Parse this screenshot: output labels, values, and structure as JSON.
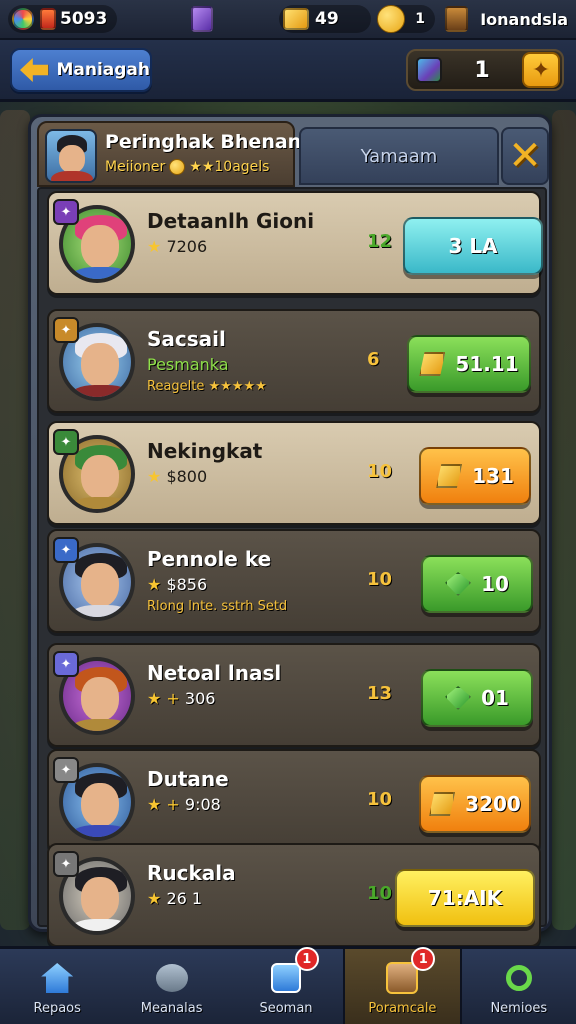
{
  "top_bar": {
    "gems": "5093",
    "gold": "49",
    "coins": "1",
    "player": "Ionandsla"
  },
  "header": {
    "back_label": "Maniagah",
    "counter_value": "1"
  },
  "panel": {
    "tab_title": "Peringhak Bhenan",
    "tab_subtitle_left": "Meiioner",
    "tab_subtitle_right": "★★10agels",
    "tab_inactive": "Yamaam"
  },
  "rows": [
    {
      "name": "Detaanlh Gioni",
      "sub": "7206",
      "sub2": "",
      "level": "12",
      "price": "3 LA",
      "style": "light",
      "button": "teal",
      "sub_prefix": "★"
    },
    {
      "name": "Sacsail",
      "sub": "Pesmanka",
      "sub2": "Reagelte ★★★★★",
      "level": "6",
      "price": "51.11",
      "style": "dark",
      "button": "green-gold",
      "sub_prefix": ""
    },
    {
      "name": "Nekingkat",
      "sub": "$800",
      "sub2": "",
      "level": "10",
      "price": "131",
      "style": "light",
      "button": "orange-gold",
      "sub_prefix": "★"
    },
    {
      "name": "Pennole ke",
      "sub": "$856",
      "sub2": "Rlong lnte. sstrh Setd",
      "level": "10",
      "price": "10",
      "style": "dark",
      "button": "green-gem",
      "sub_prefix": "★"
    },
    {
      "name": "Netoal lnasl",
      "sub": "306",
      "sub2": "",
      "level": "13",
      "price": "01",
      "style": "dark",
      "button": "green-gem",
      "sub_prefix": "★ +"
    },
    {
      "name": "Dutane",
      "sub": "9:08",
      "sub2": "",
      "level": "10",
      "price": "3200",
      "style": "dark",
      "button": "orange-gold",
      "sub_prefix": "★ +"
    },
    {
      "name": "Ruckala",
      "sub": "26 1",
      "sub2": "",
      "level": "10",
      "price": "71:AIK",
      "style": "dark",
      "button": "yellow",
      "sub_prefix": "★"
    }
  ],
  "bottom_nav": [
    {
      "label": "Repaos",
      "icon": "home-icon",
      "badge": ""
    },
    {
      "label": "Meanalas",
      "icon": "chat-icon",
      "badge": ""
    },
    {
      "label": "Seoman",
      "icon": "quest-icon",
      "badge": "1"
    },
    {
      "label": "Poramcale",
      "icon": "heroes-icon",
      "badge": "1"
    },
    {
      "label": "Nemioes",
      "icon": "search-icon",
      "badge": ""
    }
  ]
}
